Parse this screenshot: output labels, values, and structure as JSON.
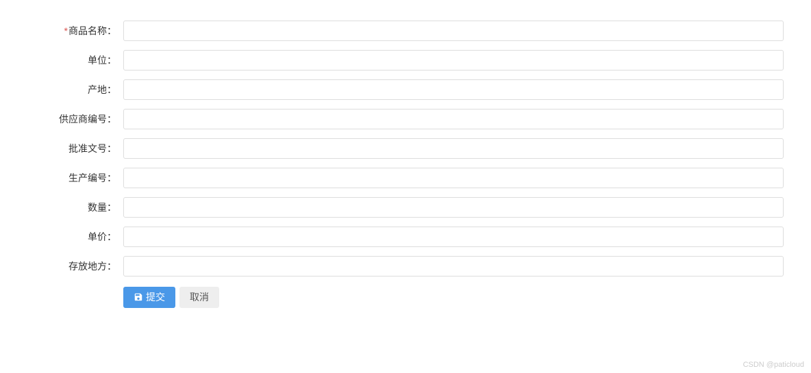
{
  "form": {
    "fields": [
      {
        "label": "商品名称：",
        "required": true,
        "value": "",
        "name": "product-name"
      },
      {
        "label": "单位：",
        "required": false,
        "value": "",
        "name": "unit"
      },
      {
        "label": "产地：",
        "required": false,
        "value": "",
        "name": "origin"
      },
      {
        "label": "供应商编号：",
        "required": false,
        "value": "",
        "name": "supplier-id"
      },
      {
        "label": "批准文号：",
        "required": false,
        "value": "",
        "name": "approval-number"
      },
      {
        "label": "生产编号：",
        "required": false,
        "value": "",
        "name": "production-number"
      },
      {
        "label": "数量：",
        "required": false,
        "value": "",
        "name": "quantity"
      },
      {
        "label": "单价：",
        "required": false,
        "value": "",
        "name": "unit-price"
      },
      {
        "label": "存放地方：",
        "required": false,
        "value": "",
        "name": "storage-location"
      }
    ],
    "required_mark": "*",
    "submit_label": "提交",
    "cancel_label": "取消"
  },
  "watermark": "CSDN @paticloud"
}
